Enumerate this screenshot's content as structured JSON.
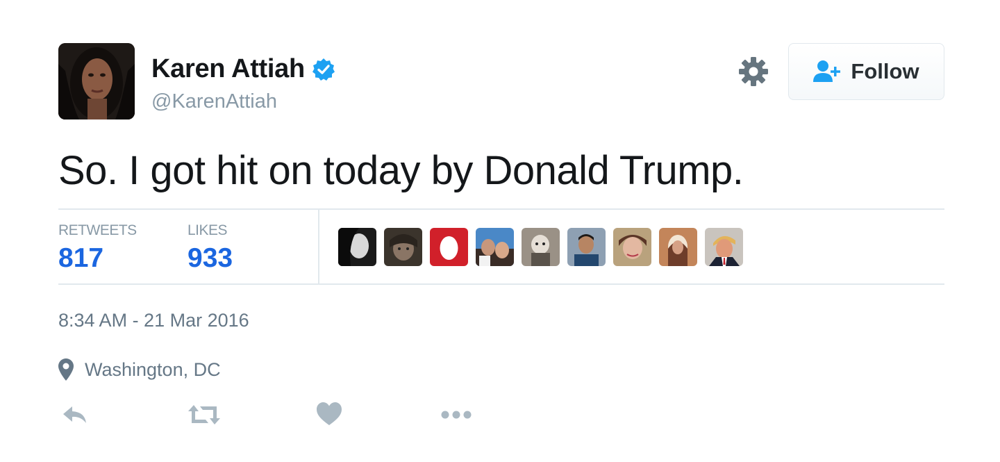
{
  "user": {
    "name": "Karen Attiah",
    "handle": "@KarenAttiah",
    "verified_icon": "verified-badge-icon"
  },
  "header": {
    "settings_icon": "gear-icon",
    "follow_label": "Follow",
    "follow_icon": "add-user-icon"
  },
  "tweet": {
    "text": "So. I got hit on today by Donald Trump."
  },
  "stats": {
    "retweets_label": "RETWEETS",
    "retweets_count": "817",
    "likes_label": "LIKES",
    "likes_count": "933",
    "liker_avatars": [
      "liker-avatar-1",
      "liker-avatar-2",
      "liker-avatar-3",
      "liker-avatar-4",
      "liker-avatar-5",
      "liker-avatar-6",
      "liker-avatar-7",
      "liker-avatar-8",
      "liker-avatar-9"
    ]
  },
  "meta": {
    "timestamp": "8:34 AM - 21 Mar 2016",
    "location": "Washington, DC",
    "location_icon": "location-pin-icon"
  },
  "actions": {
    "reply_icon": "reply-icon",
    "retweet_icon": "retweet-icon",
    "like_icon": "heart-icon",
    "more_icon": "more-icon"
  },
  "colors": {
    "link_blue": "#1b66e0",
    "verified_blue": "#1da1f2",
    "muted_gray": "#8899a6",
    "border": "#e1e8ed"
  }
}
